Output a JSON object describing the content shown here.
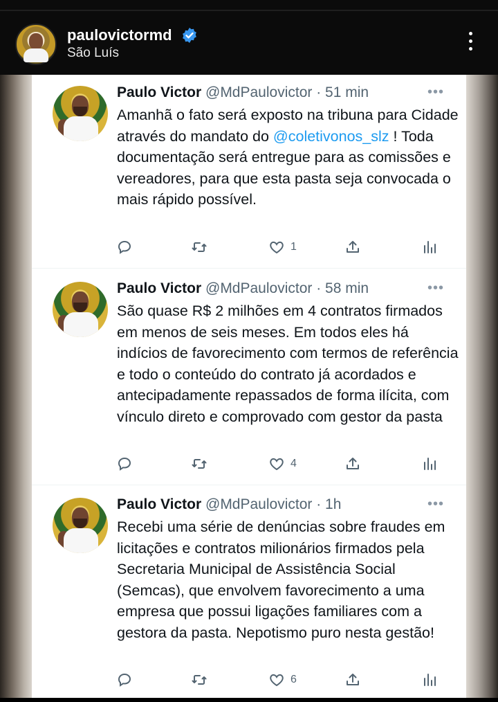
{
  "header": {
    "username": "paulovictormd",
    "location": "São Luís"
  },
  "tweets": [
    {
      "name": "Paulo Victor",
      "handle": "@MdPaulovictor",
      "time": "51 min",
      "text_before": "Amanhã o fato será exposto na tribuna para Cidade através do mandato do ",
      "mention": "@coletivonos_slz",
      "text_after": " ! Toda documentação será entregue para as comissões e vereadores, para que esta pasta seja convocada o mais rápido possível.",
      "likes": "1"
    },
    {
      "name": "Paulo Victor",
      "handle": "@MdPaulovictor",
      "time": "58 min",
      "text": "São quase R$ 2 milhões em 4 contratos firmados em menos de seis meses. Em todos eles há indícios de favorecimento com termos de referência e todo o conteúdo do contrato já acordados e antecipadamente repassados de forma ilícita, com vínculo direto e comprovado com gestor da pasta",
      "likes": "4"
    },
    {
      "name": "Paulo Victor",
      "handle": "@MdPaulovictor",
      "time": "1h",
      "text": "Recebi uma série de denúncias sobre fraudes em licitações e contratos milionários firmados pela Secretaria Municipal de Assistência Social (Semcas), que envolvem favorecimento a uma empresa que possui ligações familiares com a gestora da pasta. Nepotismo puro nesta gestão!",
      "likes": "6"
    }
  ],
  "separator": " · ",
  "more_glyph": "•••",
  "icons": [
    "verified-badge-icon",
    "more-vertical-icon",
    "reply-icon",
    "retweet-icon",
    "heart-icon",
    "share-icon",
    "analytics-icon"
  ],
  "colors": {
    "link": "#1d9bf0",
    "verified": "#3897f0",
    "text": "#0f1419",
    "muted": "#536471"
  }
}
